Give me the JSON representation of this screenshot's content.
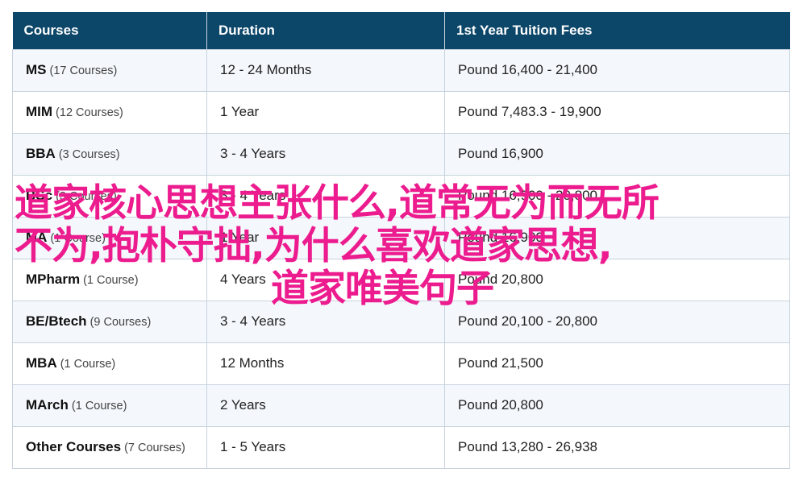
{
  "table": {
    "headers": [
      "Courses",
      "Duration",
      "1st Year Tuition Fees"
    ],
    "rows": [
      {
        "name": "MS",
        "count": "(17 Courses)",
        "duration": "12 - 24 Months",
        "fees": "Pound 16,400 - 21,400"
      },
      {
        "name": "MIM",
        "count": "(12 Courses)",
        "duration": "1 Year",
        "fees": "Pound 7,483.3 - 19,900"
      },
      {
        "name": "BBA",
        "count": "(3 Courses)",
        "duration": "3 - 4 Years",
        "fees": "Pound 16,900"
      },
      {
        "name": "BSc",
        "count": "(3 Courses)",
        "duration": "3 - 4 Years",
        "fees": "Pound 16,900 - 20,800"
      },
      {
        "name": "MA",
        "count": "(1 Course)",
        "duration": "1 Year",
        "fees": "Pound 16,900"
      },
      {
        "name": "MPharm",
        "count": "(1 Course)",
        "duration": "4 Years",
        "fees": "Pound 20,800"
      },
      {
        "name": "BE/Btech",
        "count": "(9 Courses)",
        "duration": "3 - 4 Years",
        "fees": "Pound 20,100 - 20,800"
      },
      {
        "name": "MBA",
        "count": "(1 Course)",
        "duration": "12 Months",
        "fees": "Pound 21,500"
      },
      {
        "name": "MArch",
        "count": "(1 Course)",
        "duration": "2 Years",
        "fees": "Pound 20,800"
      },
      {
        "name": "Other Courses",
        "count": "(7 Courses)",
        "duration": "1 - 5 Years",
        "fees": "Pound 13,280 - 26,938"
      }
    ]
  },
  "overlay": {
    "line1": "道家核心思想主张什么,道常无为而无所",
    "line2": "不为,抱朴守拙,为什么喜欢道家思想,",
    "line3": "道家唯美句子",
    "color": "#ec1c8f"
  },
  "colors": {
    "header_bg": "#0c4669",
    "row_alt_bg": "#f4f8fc",
    "border": "#c7d2de"
  }
}
